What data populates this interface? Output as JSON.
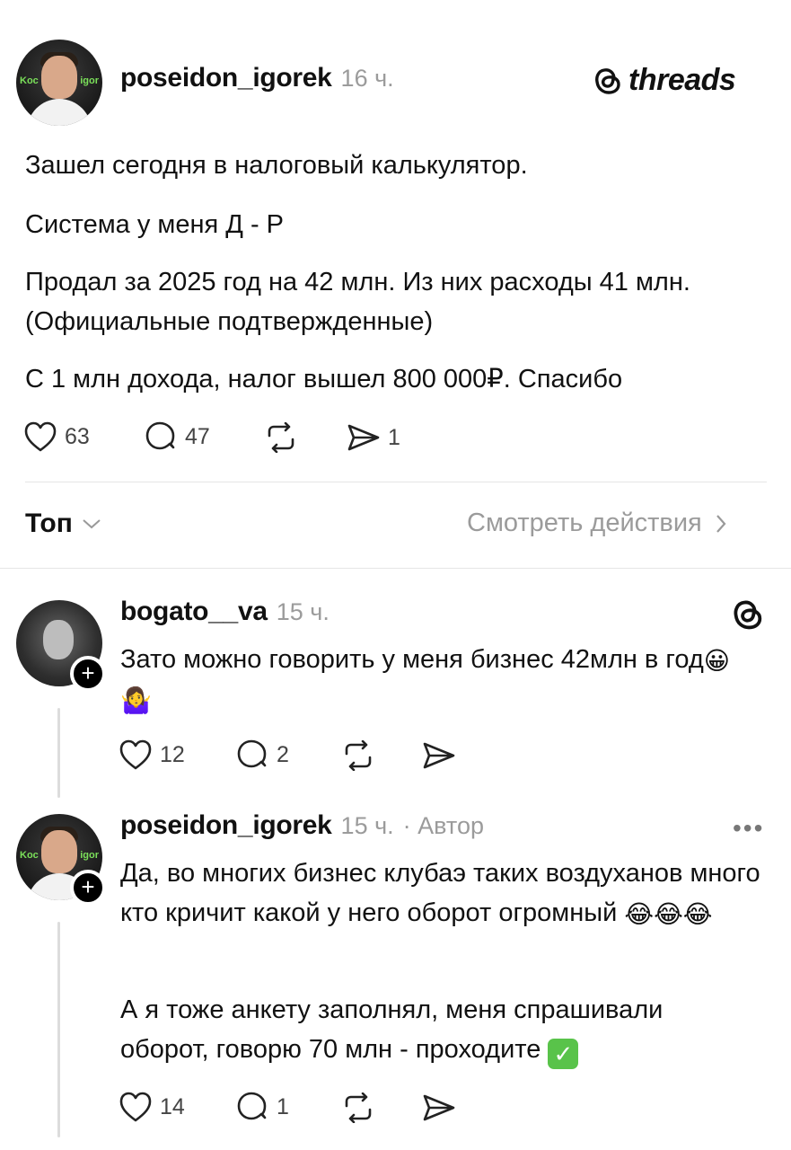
{
  "brand": {
    "name": "threads"
  },
  "post": {
    "username": "poseidon_igorek",
    "time": "16 ч.",
    "avatar_tag_left": "Koc",
    "avatar_tag_right": "igor",
    "paragraphs": [
      "Зашел сегодня в налоговый калькулятор.",
      "Система у меня Д - Р",
      "Продал за 2025 год на 42 млн. Из них расходы 41 млн. (Официальные подтвержденные)",
      "С 1 млн дохода, налог вышел 800 000₽. Спасибо"
    ],
    "likes": "63",
    "comments": "47",
    "shares": "1"
  },
  "sort": {
    "label": "Топ",
    "view_activity": "Смотреть действия"
  },
  "replies": [
    {
      "username": "bogato__va",
      "time": "15 ч.",
      "text": "Зато можно говорить у меня бизнес 42млн в год",
      "emojis": [
        "😀",
        "🤷‍♀️"
      ],
      "likes": "12",
      "comments": "2"
    },
    {
      "username": "poseidon_igorek",
      "time": "15 ч.",
      "author_label": "· Автор",
      "avatar_tag_left": "Koc",
      "avatar_tag_right": "igor",
      "paragraph1": "Да, во многих бизнес клубаэ таких воздуханов много кто кричит какой у него оборот огромный",
      "emojis": [
        "😂",
        "😂",
        "😂"
      ],
      "paragraph2": "А я тоже анкету заполнял, меня спрашивали оборот, говорю 70 млн - проходите",
      "check": "✓",
      "more": "•••",
      "likes": "14",
      "comments": "1"
    }
  ]
}
